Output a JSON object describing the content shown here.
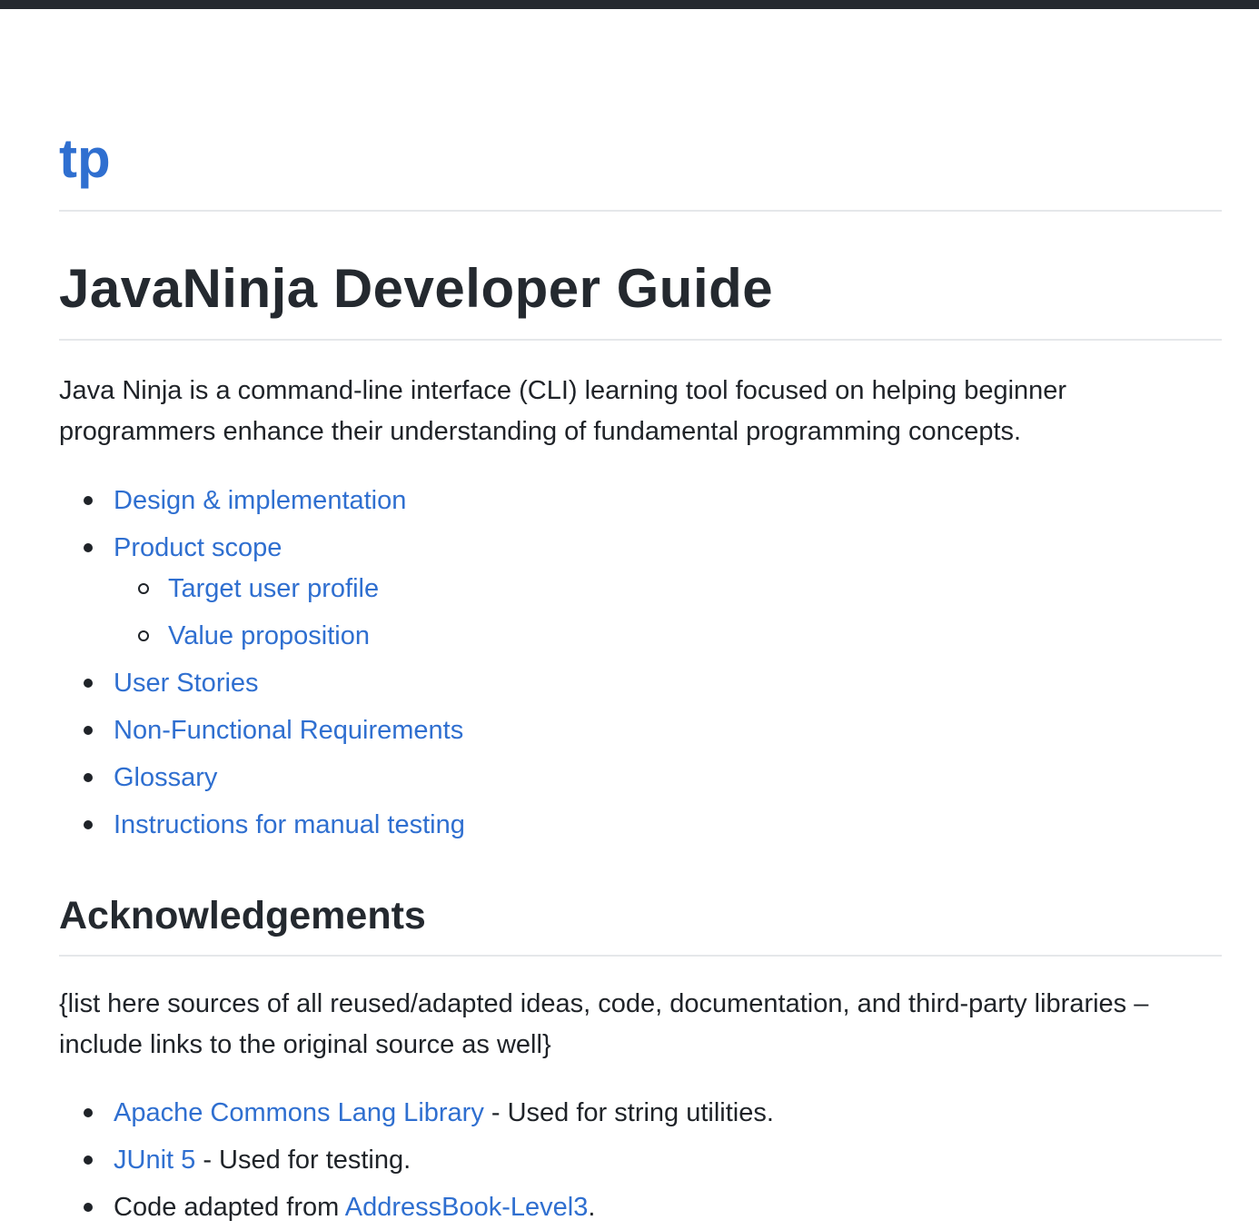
{
  "site": {
    "title": "tp"
  },
  "page": {
    "title": "JavaNinja Developer Guide",
    "intro": "Java Ninja is a command-line interface (CLI) learning tool focused on helping beginner programmers enhance their understanding of fundamental programming concepts."
  },
  "toc": {
    "items": [
      {
        "label": "Design & implementation"
      },
      {
        "label": "Product scope",
        "children": [
          {
            "label": "Target user profile"
          },
          {
            "label": "Value proposition"
          }
        ]
      },
      {
        "label": "User Stories"
      },
      {
        "label": "Non-Functional Requirements"
      },
      {
        "label": "Glossary"
      },
      {
        "label": "Instructions for manual testing"
      }
    ]
  },
  "acknowledgements": {
    "heading": "Acknowledgements",
    "paragraph": "{list here sources of all reused/adapted ideas, code, documentation, and third-party libraries – include links to the original source as well}",
    "items": [
      {
        "prefix": "",
        "link": "Apache Commons Lang Library",
        "suffix": " - Used for string utilities."
      },
      {
        "prefix": "",
        "link": "JUnit 5",
        "suffix": " - Used for testing."
      },
      {
        "prefix": "Code adapted from ",
        "link": "AddressBook-Level3",
        "suffix": "."
      }
    ]
  },
  "colors": {
    "link": "#2f6fd0",
    "text": "#1f2328",
    "top_bar": "#24292f",
    "divider": "#e5e7ea"
  }
}
